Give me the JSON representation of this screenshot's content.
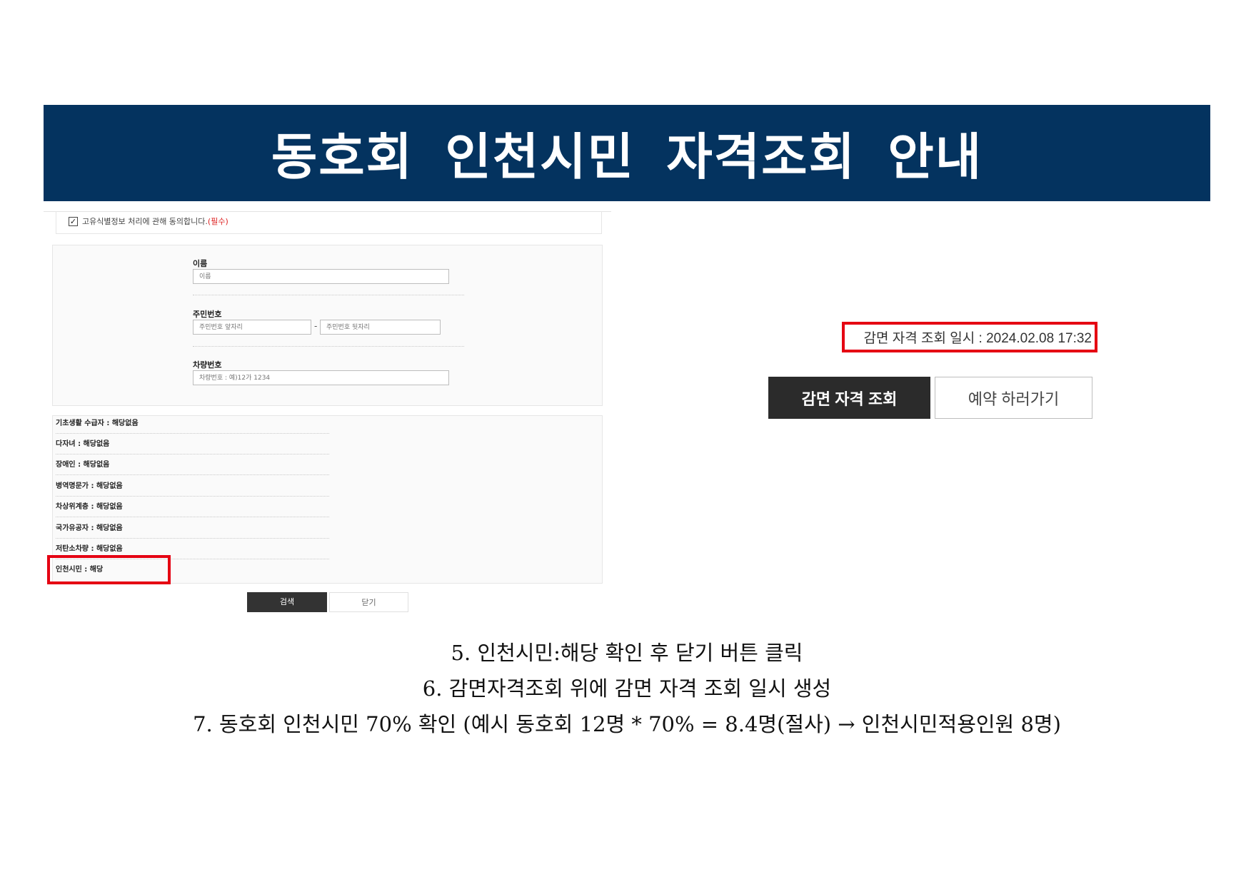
{
  "banner": {
    "title": "동호회 인천시민 자격조회 안내"
  },
  "consent": {
    "text": "고유식별정보 처리에 관해 동의합니다.",
    "required": "(필수)",
    "checked": true
  },
  "form": {
    "name_label": "이름",
    "name_placeholder": "이름",
    "rrn_label": "주민번호",
    "rrn_front_placeholder": "주민번호 앞자리",
    "rrn_separator": "-",
    "rrn_back_placeholder": "주민번호 뒷자리",
    "car_label": "차량번호",
    "car_placeholder": "차량번호 : 예)12가 1234"
  },
  "results": [
    "기초생활 수급자 : 해당없음",
    "다자녀 : 해당없음",
    "장애인 : 해당없음",
    "병역명문가 : 해당없음",
    "차상위계층 : 해당없음",
    "국가유공자 : 해당없음",
    "저탄소차량 : 해당없음",
    "인천시민 : 해당"
  ],
  "buttons": {
    "search": "검색",
    "close": "닫기",
    "check_eligibility": "감면 자격 조회",
    "go_reserve": "예약 하러가기"
  },
  "check_time": "감면 자격 조회 일시 : 2024.02.08 17:32",
  "instructions": [
    "5. 인천시민:해당 확인 후 닫기 버튼 클릭",
    "6. 감면자격조회 위에 감면 자격 조회 일시 생성",
    "7. 동호회 인천시민 70% 확인 (예시 동호회 12명 * 70% = 8.4명(절사) → 인천시민적용인원 8명)"
  ]
}
